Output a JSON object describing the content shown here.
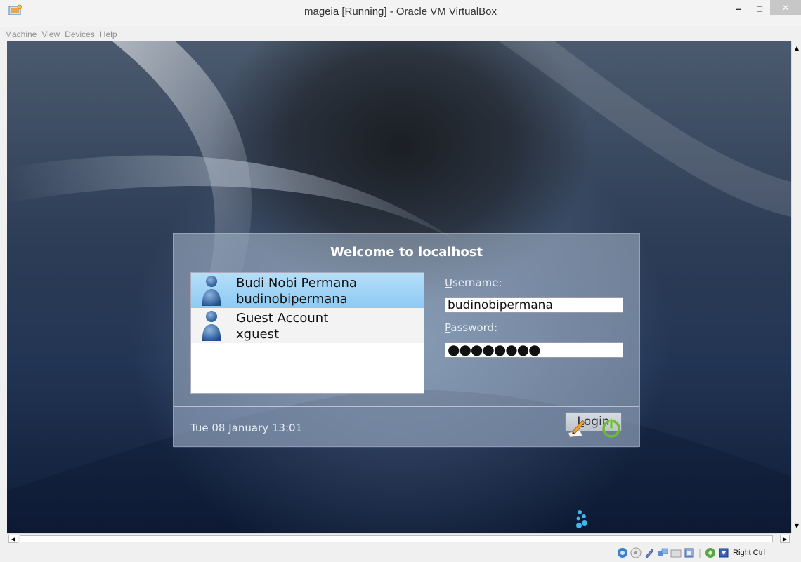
{
  "window": {
    "title": "mageia [Running] - Oracle VM VirtualBox",
    "minimize_label": "–",
    "maximize_label": "□",
    "close_label": "✕"
  },
  "menubar": {
    "items": [
      "Machine",
      "View",
      "Devices",
      "Help"
    ]
  },
  "login": {
    "welcome": "Welcome to localhost",
    "users": [
      {
        "name": "Budi Nobi Permana",
        "login": "budinobipermana",
        "selected": true
      },
      {
        "name": "Guest Account",
        "login": "xguest",
        "selected": false
      }
    ],
    "username_label_first": "U",
    "username_label_rest": "sername:",
    "username_value": "budinobipermana",
    "password_label_first": "P",
    "password_label_rest": "assword:",
    "password_value": "●●●●●●●●",
    "login_button_first": "L",
    "login_button_rest": "ogin",
    "datetime": "Tue 08 January 13:01"
  },
  "statusbar": {
    "host_key": "Right Ctrl",
    "icons": [
      "hard-disk-icon",
      "optical-drive-icon",
      "usb-icon",
      "network-icon",
      "shared-folders-icon",
      "display-icon",
      "capture-icon",
      "mouse-integration-icon"
    ]
  },
  "colors": {
    "selected_row": "#8ccaf3",
    "power_icon": "#6dbb2e",
    "title_bar": "#f3f3f3"
  }
}
